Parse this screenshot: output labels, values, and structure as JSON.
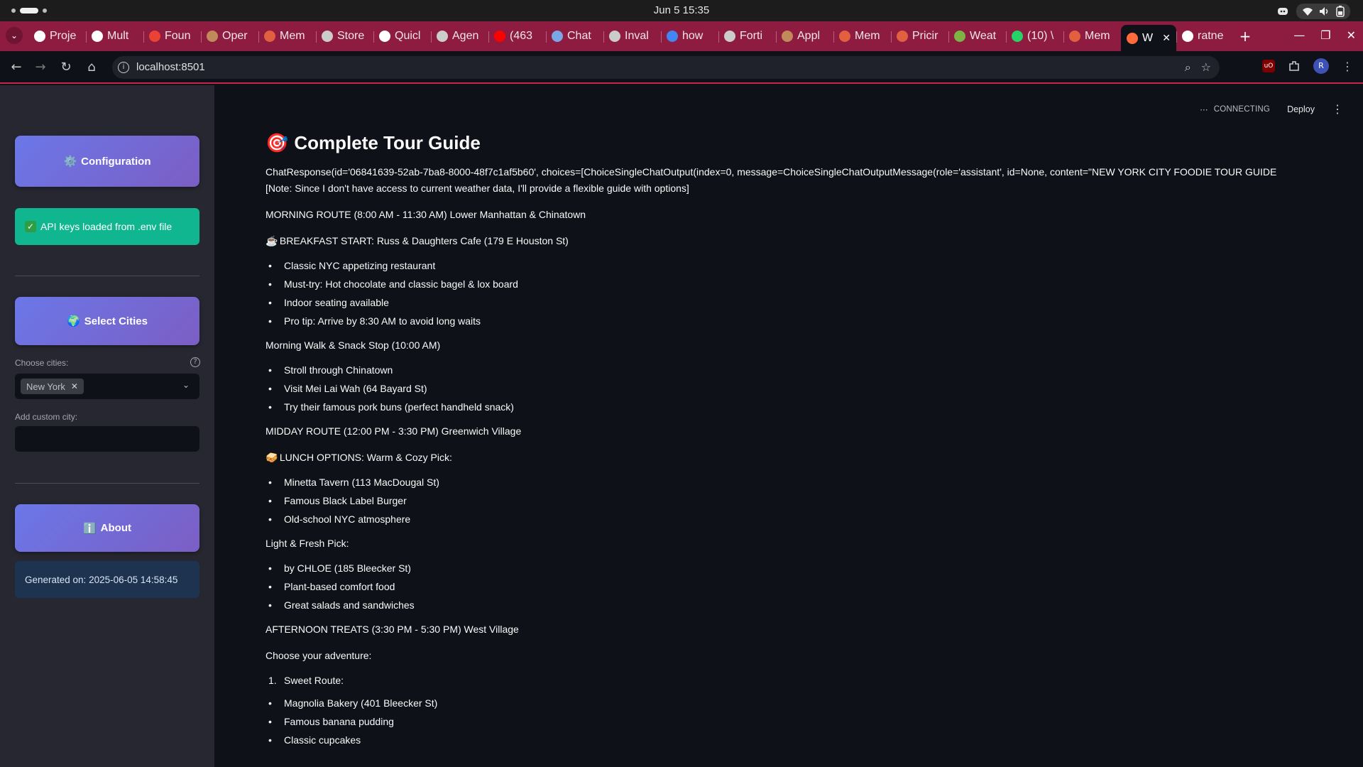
{
  "os": {
    "clock": "Jun 5  15:35"
  },
  "browser": {
    "tabs": [
      {
        "label": "Proje",
        "color": "#ffffff"
      },
      {
        "label": "Mult",
        "color": "#ffffff"
      },
      {
        "label": "Foun",
        "color": "#ea4335"
      },
      {
        "label": "Oper",
        "color": "#c08a5a"
      },
      {
        "label": "Mem",
        "color": "#e06040"
      },
      {
        "label": "Store",
        "color": "#cccccc"
      },
      {
        "label": "Quicl",
        "color": "#ffffff"
      },
      {
        "label": "Agen",
        "color": "#cccccc"
      },
      {
        "label": "(463",
        "color": "#ff0000"
      },
      {
        "label": "Chat",
        "color": "#7aa7e6"
      },
      {
        "label": "Inval",
        "color": "#cccccc"
      },
      {
        "label": "how",
        "color": "#4285f4"
      },
      {
        "label": "Forti",
        "color": "#cccccc"
      },
      {
        "label": "Appl",
        "color": "#c08a5a"
      },
      {
        "label": "Mem",
        "color": "#e06040"
      },
      {
        "label": "Pricir",
        "color": "#e06040"
      },
      {
        "label": "Weat",
        "color": "#7cb342"
      },
      {
        "label": "(10) \\",
        "color": "#25d366"
      },
      {
        "label": "Mem",
        "color": "#e06040"
      }
    ],
    "active_tab": {
      "label": "W",
      "color": "#ff6b3d"
    },
    "after_tab": {
      "label": "ratne",
      "color": "#ffffff"
    },
    "url": "localhost:8501",
    "profile_initial": "R"
  },
  "sidebar": {
    "config_label": "Configuration",
    "config_icon": "gear-icon",
    "api_status": "API keys loaded from .env file",
    "select_cities_label": "Select Cities",
    "choose_cities_label": "Choose cities:",
    "selected_city": "New York",
    "add_custom_label": "Add custom city:",
    "custom_city_value": "",
    "about_label": "About",
    "generated_on": "Generated on: 2025-06-05 14:58:45"
  },
  "app": {
    "status": "CONNECTING",
    "deploy_label": "Deploy"
  },
  "guide": {
    "title": "Complete Tour Guide",
    "response_text": "ChatResponse(id='06841639-52ab-7ba8-8000-48f7c1af5b60', choices=[ChoiceSingleChatOutput(index=0, message=ChoiceSingleChatOutputMessage(role='assistant', id=None, content=\"NEW YORK CITY FOODIE TOUR GUIDE [Note: Since I don't have access to current weather data, I'll provide a flexible guide with options]",
    "morning_route": "MORNING ROUTE (8:00 AM - 11:30 AM) Lower Manhattan & Chinatown",
    "breakfast_start": "BREAKFAST START: Russ & Daughters Cafe (179 E Houston St)",
    "breakfast_items": [
      "Classic NYC appetizing restaurant",
      "Must-try: Hot chocolate and classic bagel & lox board",
      "Indoor seating available",
      "Pro tip: Arrive by 8:30 AM to avoid long waits"
    ],
    "morning_walk": "Morning Walk & Snack Stop (10:00 AM)",
    "walk_items": [
      "Stroll through Chinatown",
      "Visit Mei Lai Wah (64 Bayard St)",
      "Try their famous pork buns (perfect handheld snack)"
    ],
    "midday_route": "MIDDAY ROUTE (12:00 PM - 3:30 PM) Greenwich Village",
    "lunch_options": "LUNCH OPTIONS: Warm & Cozy Pick:",
    "lunch_items": [
      "Minetta Tavern (113 MacDougal St)",
      "Famous Black Label Burger",
      "Old-school NYC atmosphere"
    ],
    "light_fresh": "Light & Fresh Pick:",
    "light_items": [
      "by CHLOE (185 Bleecker St)",
      "Plant-based comfort food",
      "Great salads and sandwiches"
    ],
    "afternoon_treats": "AFTERNOON TREATS (3:30 PM - 5:30 PM) West Village",
    "choose_adventure": "Choose your adventure:",
    "adventure_num": "1.",
    "adventure_label": "Sweet Route:",
    "sweet_items": [
      "Magnolia Bakery (401 Bleecker St)",
      "Famous banana pudding",
      "Classic cupcakes"
    ]
  }
}
